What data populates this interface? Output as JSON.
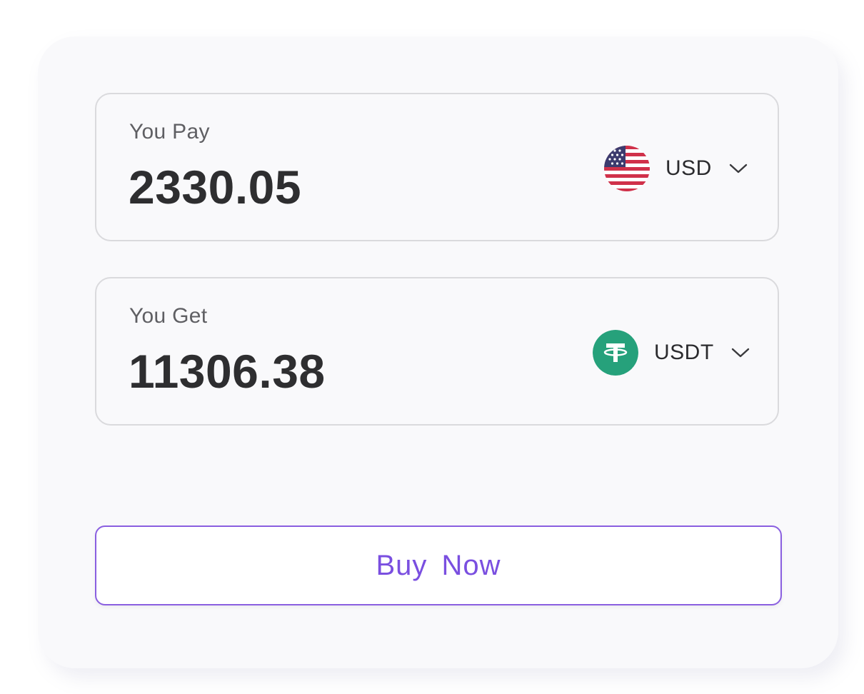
{
  "pay": {
    "label": "You Pay",
    "amount": "2330.05",
    "currency_code": "USD",
    "currency_icon": "us-flag-icon"
  },
  "get": {
    "label": "You Get",
    "amount": "11306.38",
    "currency_code": "USDT",
    "currency_icon": "tether-icon"
  },
  "buy_button": {
    "label": "Buy  Now"
  },
  "colors": {
    "accent": "#7a4fe0",
    "tether": "#26a17b",
    "card_background": "#f9f9fb"
  }
}
